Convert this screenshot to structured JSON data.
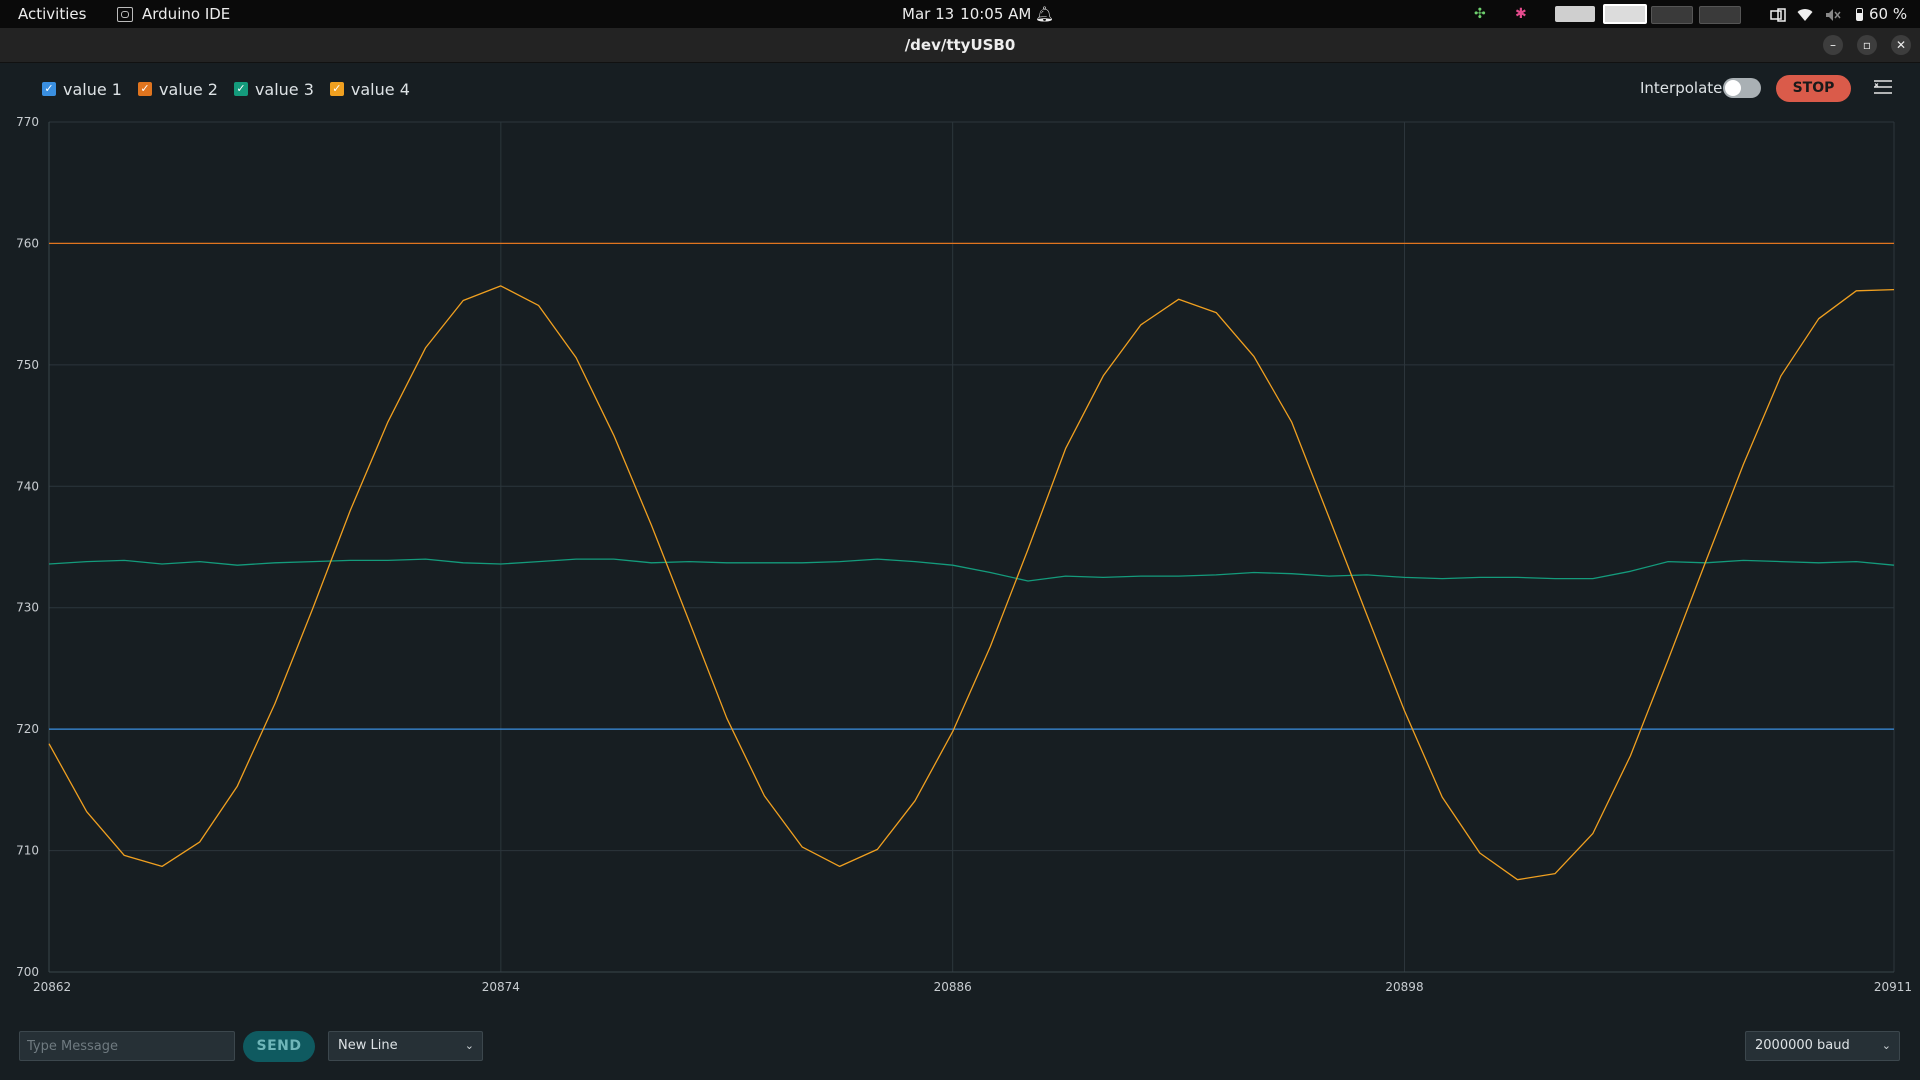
{
  "topbar": {
    "activities": "Activities",
    "app_name": "Arduino IDE",
    "date": "Mar 13",
    "time": "10:05 AM",
    "battery": "60 %"
  },
  "window": {
    "title": "/dev/ttyUSB0"
  },
  "toolbar": {
    "interpolate_label": "Interpolate",
    "interpolate_on": false,
    "stop_label": "STOP"
  },
  "legend": [
    {
      "label": "value 1",
      "color": "#3a8fe0",
      "checked": true
    },
    {
      "label": "value 2",
      "color": "#e0751f",
      "checked": true
    },
    {
      "label": "value 3",
      "color": "#149b7c",
      "checked": true
    },
    {
      "label": "value 4",
      "color": "#f0a020",
      "checked": true
    }
  ],
  "bottom": {
    "message_placeholder": "Type Message",
    "send_label": "SEND",
    "line_ending": "New Line",
    "baud": "2000000 baud"
  },
  "chart_data": {
    "type": "line",
    "title": "",
    "xlabel": "",
    "ylabel": "",
    "xlim": [
      20862,
      20911
    ],
    "ylim": [
      700,
      770
    ],
    "x_ticks": [
      20862,
      20874,
      20886,
      20898,
      20911
    ],
    "y_ticks": [
      700,
      710,
      720,
      730,
      740,
      750,
      760,
      770
    ],
    "grid": true,
    "legend": "top-left",
    "series": [
      {
        "name": "value 1",
        "color": "#3a8fe0",
        "x": [
          20862,
          20911
        ],
        "values": [
          720,
          720
        ]
      },
      {
        "name": "value 2",
        "color": "#e0751f",
        "x": [
          20862,
          20911
        ],
        "values": [
          760,
          760
        ]
      },
      {
        "name": "value 3",
        "color": "#149b7c",
        "x": [
          20862,
          20863,
          20864,
          20865,
          20866,
          20867,
          20868,
          20869,
          20870,
          20871,
          20872,
          20873,
          20874,
          20875,
          20876,
          20877,
          20878,
          20879,
          20880,
          20881,
          20882,
          20883,
          20884,
          20885,
          20886,
          20887,
          20888,
          20889,
          20890,
          20891,
          20892,
          20893,
          20894,
          20895,
          20896,
          20897,
          20898,
          20899,
          20900,
          20901,
          20902,
          20903,
          20904,
          20905,
          20906,
          20907,
          20908,
          20909,
          20910,
          20911
        ],
        "values": [
          733.6,
          733.8,
          733.9,
          733.6,
          733.8,
          733.5,
          733.7,
          733.8,
          733.9,
          733.9,
          734.0,
          733.7,
          733.6,
          733.8,
          734.0,
          734.0,
          733.7,
          733.8,
          733.7,
          733.7,
          733.7,
          733.8,
          734.0,
          733.8,
          733.5,
          732.9,
          732.2,
          732.6,
          732.5,
          732.6,
          732.6,
          732.7,
          732.9,
          732.8,
          732.6,
          732.7,
          732.5,
          732.4,
          732.5,
          732.5,
          732.4,
          732.4,
          733.0,
          733.8,
          733.7,
          733.9,
          733.8,
          733.7,
          733.8,
          733.5
        ]
      },
      {
        "name": "value 4",
        "color": "#f0a020",
        "x": [
          20862,
          20863,
          20864,
          20865,
          20866,
          20867,
          20868,
          20869,
          20870,
          20871,
          20872,
          20873,
          20874,
          20875,
          20876,
          20877,
          20878,
          20879,
          20880,
          20881,
          20882,
          20883,
          20884,
          20885,
          20886,
          20887,
          20888,
          20889,
          20890,
          20891,
          20892,
          20893,
          20894,
          20895,
          20896,
          20897,
          20898,
          20899,
          20900,
          20901,
          20902,
          20903,
          20904,
          20905,
          20906,
          20907,
          20908,
          20909,
          20910,
          20911
        ],
        "values": [
          718.8,
          713.2,
          709.6,
          708.7,
          710.7,
          715.3,
          722.1,
          729.9,
          738.0,
          745.3,
          751.4,
          755.3,
          756.5,
          754.9,
          750.6,
          744.2,
          736.8,
          728.9,
          720.9,
          714.5,
          710.3,
          708.7,
          710.1,
          714.1,
          719.8,
          726.8,
          734.8,
          743.1,
          749.1,
          753.3,
          755.4,
          754.3,
          750.7,
          745.3,
          737.4,
          729.4,
          721.5,
          714.4,
          709.8,
          707.6,
          708.1,
          711.4,
          717.8,
          725.7,
          733.8,
          741.8,
          749.1,
          753.8,
          756.1,
          756.2
        ]
      }
    ]
  }
}
